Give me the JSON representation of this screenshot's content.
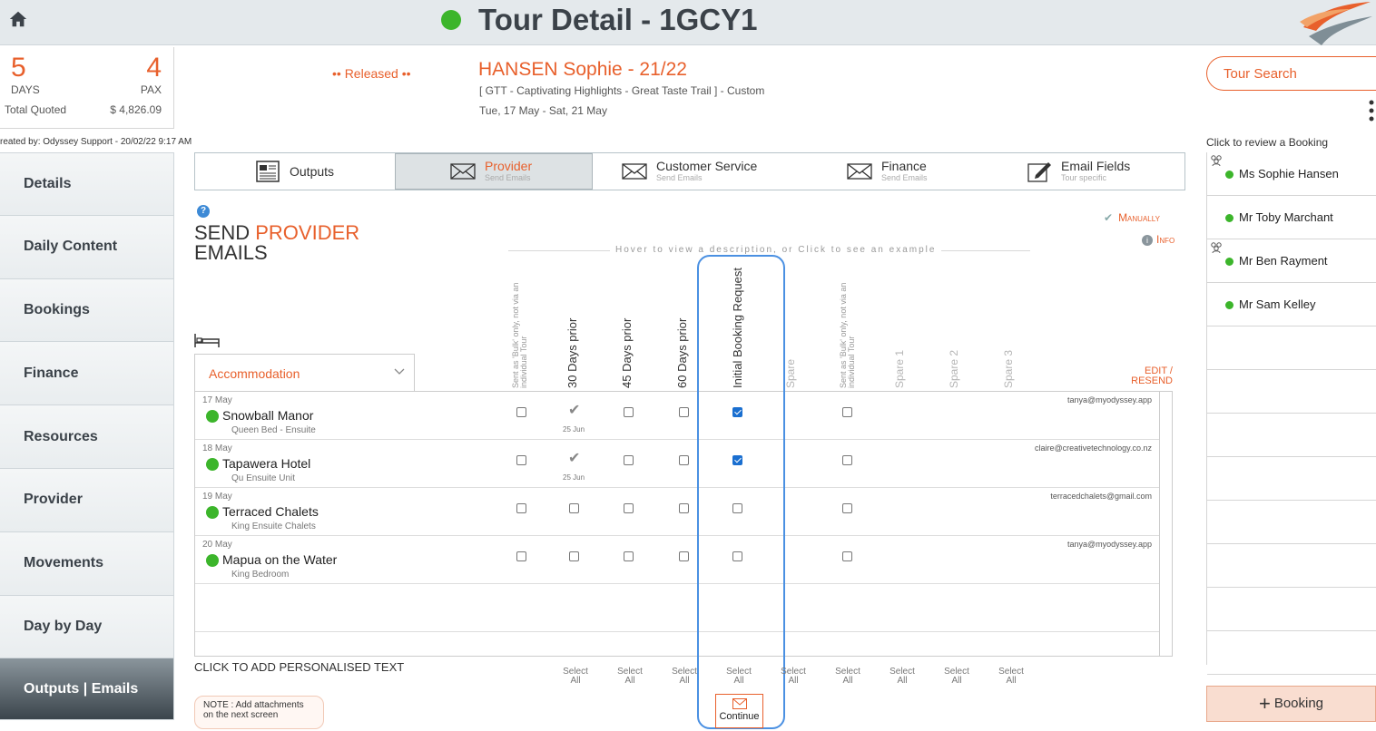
{
  "header": {
    "title": "Tour Detail - 1GCY1",
    "status_color": "#3cb52b"
  },
  "summary": {
    "days": "5",
    "days_label": "DAYS",
    "pax": "4",
    "pax_label": "PAX",
    "total_label": "Total Quoted",
    "total_value": "$ 4,826.09",
    "created_by": "reated by: Odyssey Support - 20/02/22 9:17 AM"
  },
  "tour": {
    "status": "•• Released ••",
    "client": "HANSEN Sophie - 21/22",
    "description": "[ GTT - Captivating Highlights - Great Taste Trail ] - Custom",
    "dates": "Tue, 17 May  - Sat, 21 May"
  },
  "search": {
    "label": "Tour Search"
  },
  "nav": {
    "items": [
      {
        "label": "Details",
        "active": false
      },
      {
        "label": "Daily Content",
        "active": false
      },
      {
        "label": "Bookings",
        "active": false
      },
      {
        "label": "Finance",
        "active": false
      },
      {
        "label": "Resources",
        "active": false
      },
      {
        "label": "Provider",
        "active": false
      },
      {
        "label": "Movements",
        "active": false
      },
      {
        "label": "Day by Day",
        "active": false
      },
      {
        "label": "Outputs | Emails",
        "active": true
      }
    ]
  },
  "tabs": [
    {
      "label": "Outputs",
      "sub": ""
    },
    {
      "label": "Provider",
      "sub": "Send Emails"
    },
    {
      "label": "Customer Service",
      "sub": "Send Emails"
    },
    {
      "label": "Finance",
      "sub": "Send Emails"
    },
    {
      "label": "Email Fields",
      "sub": "Tour specific"
    }
  ],
  "section": {
    "heading_prefix": "SEND ",
    "heading_highlight": "PROVIDER",
    "heading_line2": "EMAILS",
    "manually": "Manually",
    "info": "Info",
    "hover_hint": "Hover to view a description, or Click to see an example",
    "category": "Accommodation",
    "edit_resend": "EDIT / RESEND"
  },
  "columns": [
    {
      "label": "Sent as 'Bulk' only, not via an individual Tour",
      "style": "small"
    },
    {
      "label": "30 Days prior",
      "style": "normal"
    },
    {
      "label": "45 Days prior",
      "style": "normal"
    },
    {
      "label": "60 Days prior",
      "style": "normal"
    },
    {
      "label": "Initial Booking Request",
      "style": "normal"
    },
    {
      "label": "Spare",
      "style": "faint"
    },
    {
      "label": "Sent as 'Bulk' only, not via an individual Tour",
      "style": "small"
    },
    {
      "label": "Spare 1",
      "style": "faint"
    },
    {
      "label": "Spare 2",
      "style": "faint"
    },
    {
      "label": "Spare 3",
      "style": "faint"
    }
  ],
  "rows": [
    {
      "date": "17 May",
      "name": "Snowball Manor",
      "room": "Queen Bed - Ensuite",
      "email": "tanya@myodyssey.app",
      "bulk1": false,
      "d30_sent": true,
      "d30_date": "25 Jun",
      "d45": false,
      "d60": false,
      "initial": true,
      "bulk2": false
    },
    {
      "date": "18 May",
      "name": "Tapawera Hotel",
      "room": "Qu Ensuite Unit",
      "email": "claire@creativetechnology.co.nz",
      "bulk1": false,
      "d30_sent": true,
      "d30_date": "25 Jun",
      "d45": false,
      "d60": false,
      "initial": true,
      "bulk2": false
    },
    {
      "date": "19 May",
      "name": "Terraced Chalets",
      "room": "King Ensuite Chalets",
      "email": "terracedchalets@gmail.com",
      "bulk1": false,
      "d30_sent": false,
      "d30_date": "",
      "d45": false,
      "d60": false,
      "initial": false,
      "bulk2": false
    },
    {
      "date": "20 May",
      "name": "Mapua on the Water",
      "room": "King Bedroom",
      "email": "tanya@myodyssey.app",
      "bulk1": false,
      "d30_sent": false,
      "d30_date": "",
      "d45": false,
      "d60": false,
      "initial": false,
      "bulk2": false
    }
  ],
  "sent_mark": "✔",
  "bottom": {
    "personal_text": "CLICK TO ADD PERSONALISED TEXT",
    "select_all": "Select All",
    "note": "NOTE : Add attachments on the next screen",
    "continue": "Continue"
  },
  "review": {
    "label": "Click to review a Booking",
    "people": [
      {
        "name": "Ms Sophie Hansen",
        "group": true
      },
      {
        "name": "Mr Toby Marchant",
        "group": false
      },
      {
        "name": "Mr Ben Rayment",
        "group": true
      },
      {
        "name": "Mr Sam Kelley",
        "group": false
      }
    ],
    "booking_button": "Booking"
  },
  "colors": {
    "accent": "#e8602c",
    "status_green": "#3cb52b",
    "highlight": "#4a90e2"
  }
}
